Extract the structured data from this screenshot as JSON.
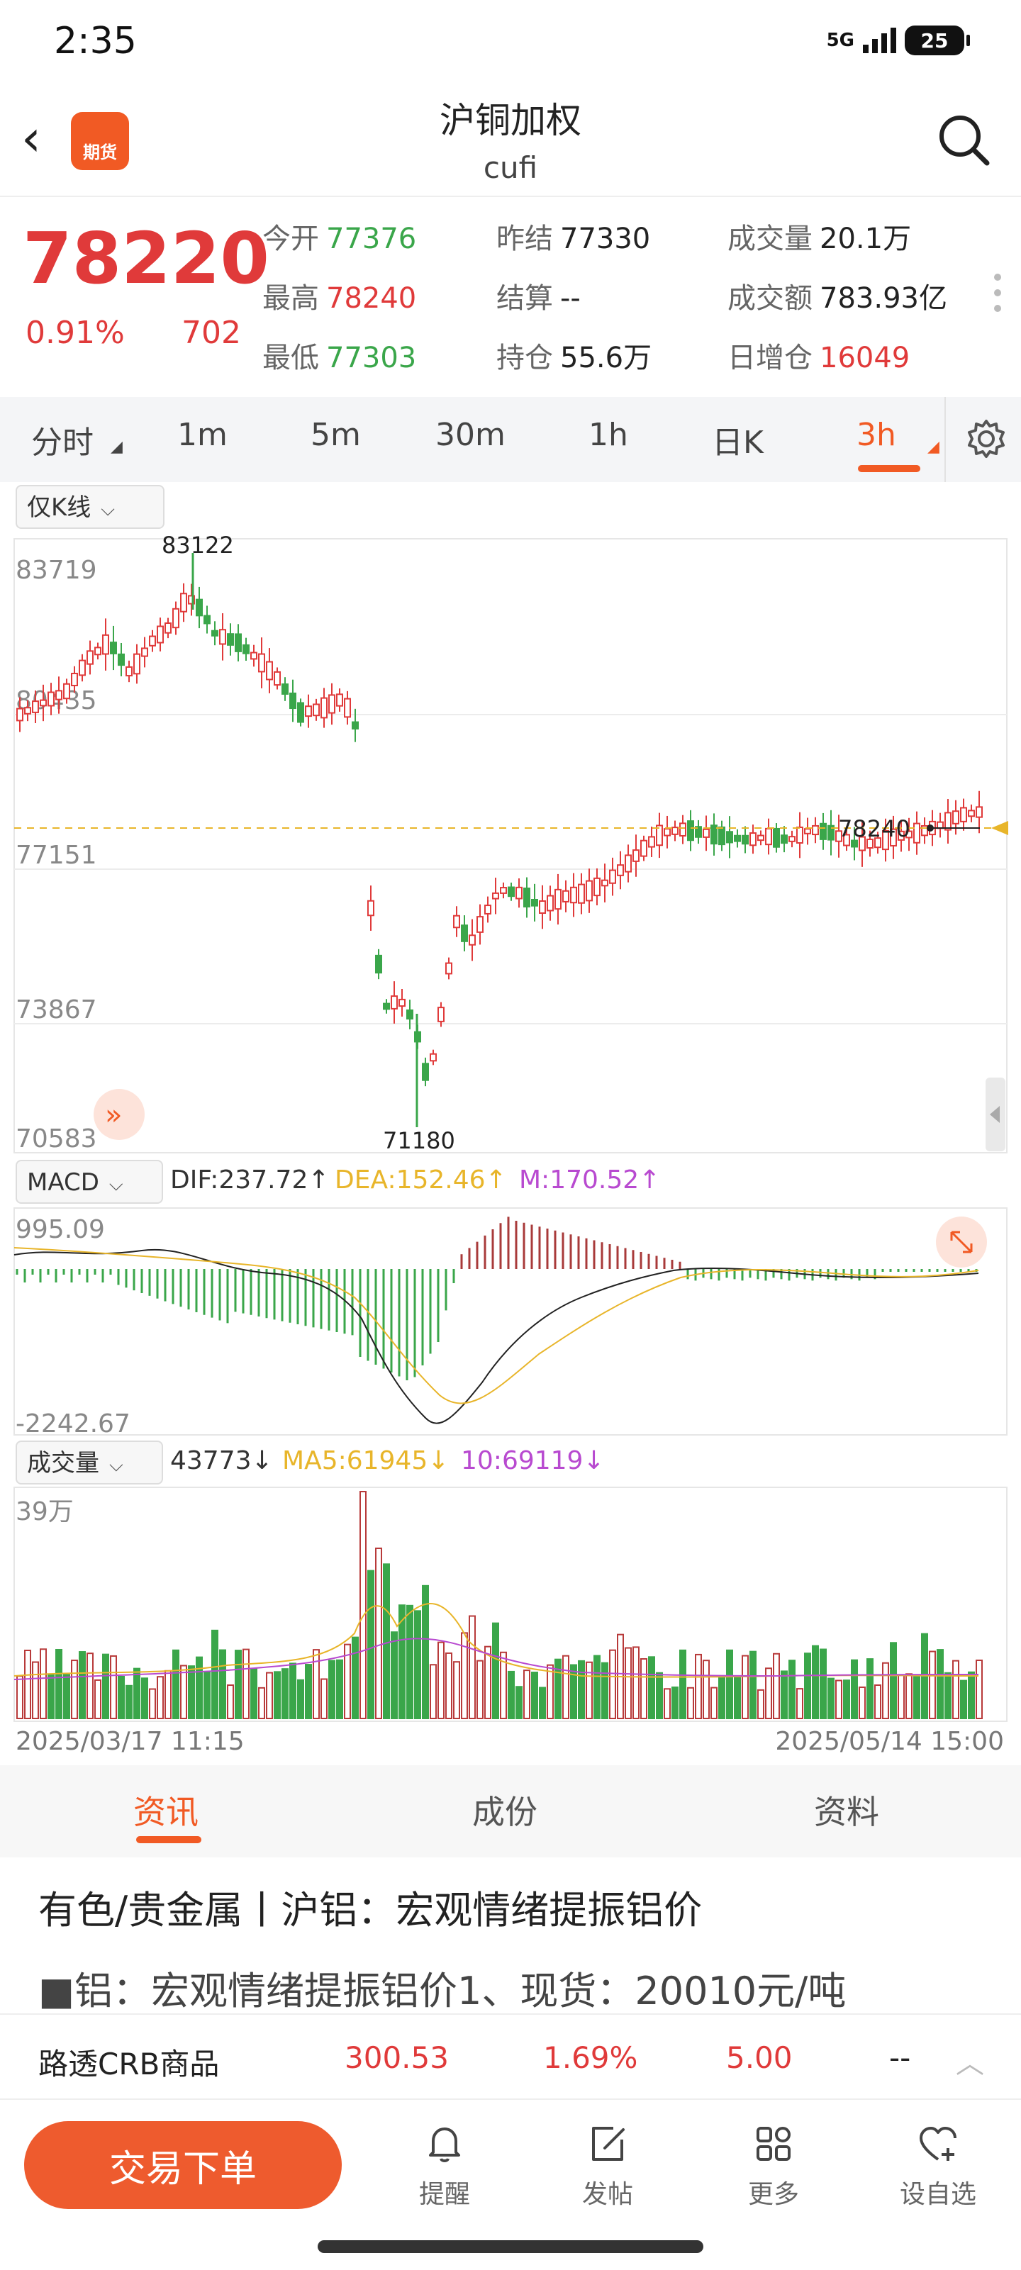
{
  "status": {
    "time": "2:35",
    "network": "5G",
    "battery": "25"
  },
  "header": {
    "title": "沪铜加权",
    "subtitle": "cufi",
    "logo_text": "期货"
  },
  "quote": {
    "price": "78220",
    "change_pct": "0.91%",
    "change": "702",
    "rows": [
      [
        {
          "label": "今开",
          "value": "77376",
          "color": "green"
        },
        {
          "label": "昨结",
          "value": "77330",
          "color": "dark"
        },
        {
          "label": "成交量",
          "value": "20.1万",
          "color": "dark"
        }
      ],
      [
        {
          "label": "最高",
          "value": "78240",
          "color": "red"
        },
        {
          "label": "结算",
          "value": "--",
          "color": "dark"
        },
        {
          "label": "成交额",
          "value": "783.93亿",
          "color": "dark"
        }
      ],
      [
        {
          "label": "最低",
          "value": "77303",
          "color": "green"
        },
        {
          "label": "持仓",
          "value": "55.6万",
          "color": "dark"
        },
        {
          "label": "日增仓",
          "value": "16049",
          "color": "red"
        }
      ]
    ]
  },
  "period_tabs": [
    "分时",
    "1m",
    "5m",
    "30m",
    "1h",
    "日K",
    "3h"
  ],
  "active_period": "3h",
  "kline": {
    "selector": "仅K线",
    "y_labels": [
      "83719",
      "80435",
      "77151",
      "73867",
      "70583"
    ],
    "high_label": "83122",
    "low_label": "71180",
    "current_line_label": "78240"
  },
  "macd": {
    "selector": "MACD",
    "dif": "DIF:237.72↑",
    "dea": "DEA:152.46↑",
    "m": "M:170.52↑",
    "y_top": "995.09",
    "y_bottom": "-2242.67"
  },
  "volume": {
    "selector": "成交量",
    "value": "43773↓",
    "ma5": "MA5:61945↓",
    "ma10": "10:69119↓",
    "y_top": "39万",
    "date_start": "2025/03/17 11:15",
    "date_end": "2025/05/14 15:00"
  },
  "sub_tabs": [
    "资讯",
    "成份",
    "资料"
  ],
  "active_sub_tab": "资讯",
  "news": {
    "title": "有色/贵金属丨沪铝：宏观情绪提振铝价",
    "body": "■铝：宏观情绪提振铝价1、现货：20010元/吨"
  },
  "ticker": {
    "name": "路透CRB商品",
    "value": "300.53",
    "pct": "1.69%",
    "change": "5.00",
    "extra": "--"
  },
  "bottom": {
    "trade": "交易下单",
    "items": [
      "提醒",
      "发帖",
      "更多",
      "设自选"
    ]
  },
  "colors": {
    "up": "#e03a3a",
    "down": "#3aa64a",
    "accent": "#f15a24",
    "dea": "#e8b52a",
    "ma10": "#b84ad0"
  }
}
